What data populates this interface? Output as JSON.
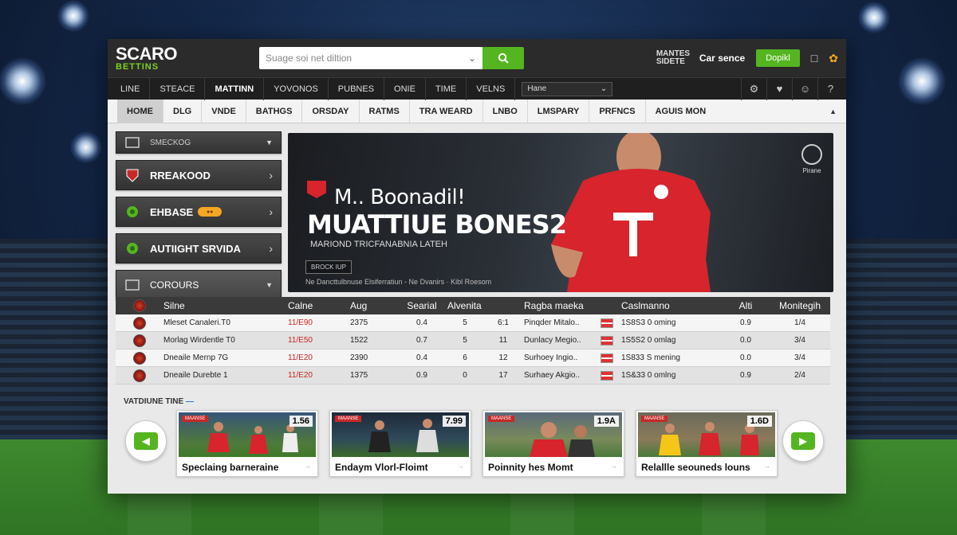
{
  "brand": {
    "line1": "SCARO",
    "line2": "BETTINS",
    "accent": "#55b520"
  },
  "search": {
    "placeholder": "Suage soi net diltion"
  },
  "topbar": {
    "link": "MANTES SIDETE",
    "user": "Car sence",
    "deposit": "Dopikl"
  },
  "nav_primary": {
    "items": [
      "LINE",
      "STEACE",
      "MATTINN",
      "YOVONOS",
      "PUBNES",
      "ONIE",
      "TIME",
      "VELNS"
    ],
    "active_index": 2,
    "select_value": "Hane"
  },
  "nav_secondary": {
    "tabs": [
      "HOME",
      "DLG",
      "VNDE",
      "BATHGS",
      "ORSDAY",
      "RATMS",
      "TRA WEARD",
      "LNBO",
      "LMSPARY",
      "PRFNCS",
      "AGUIS MON"
    ],
    "active_index": 0
  },
  "sidebar": {
    "items": [
      {
        "label": "SMECKOG"
      },
      {
        "label": "RREAKOOD"
      },
      {
        "label": "EHBASE"
      },
      {
        "label": "AUTIIGHT SRVIDA"
      },
      {
        "label": "COROURS"
      }
    ]
  },
  "hero": {
    "line1": "M.. Boonadil!",
    "line2": "MUATTIUE BONES2",
    "line3": "MARIOND TRICFANABNIA LATEH",
    "cta": "BROCK IUP",
    "fine": "Ne Dancttulbnuse Elsiferratiun - Ne Dvanirs · Kibl Roesom",
    "emblem": "Pirane"
  },
  "table": {
    "headers": [
      "Silne",
      "Calne",
      "Aug",
      "Searial",
      "Alvenita",
      "Ragba maeka",
      "Caslmanno",
      "Alti",
      "Monitegih"
    ],
    "rows": [
      {
        "name": "Mleset Canaleri.T0",
        "odds": "11/E90",
        "avg": "2375",
        "n1": "0.4",
        "n2": "5",
        "n3": "6:1",
        "partner": "Pinqder Mitalo..",
        "cash": "1S8S3 0 oming",
        "alt": "0.9",
        "mon": "1/4"
      },
      {
        "name": "Morlag Wirdentle T0",
        "odds": "11/E50",
        "avg": "1522",
        "n1": "0.7",
        "n2": "5",
        "n3": "11",
        "partner": "Dunlacy Megio..",
        "cash": "1S5S2 0 omlag",
        "alt": "0.0",
        "mon": "3/4"
      },
      {
        "name": "Dneaile Mernp 7G",
        "odds": "11/E20",
        "avg": "2390",
        "n1": "0.4",
        "n2": "6",
        "n3": "12",
        "partner": "Surhoey Ingio..",
        "cash": "1S833 S mening",
        "alt": "0.0",
        "mon": "3/4"
      },
      {
        "name": "Dneaile Durebte 1",
        "odds": "11/E20",
        "avg": "1375",
        "n1": "0.9",
        "n2": "0",
        "n3": "17",
        "partner": "Surhaey Akgio..",
        "cash": "1S&33 0 omlng",
        "alt": "0.9",
        "mon": "2/4"
      }
    ]
  },
  "featured": {
    "label": "VATDIUNE TINE",
    "dash": "—",
    "cards": [
      {
        "tag": "MAANSE",
        "odds": "1.56",
        "title": "Speclaing barneraine"
      },
      {
        "tag": "MAANSE",
        "odds": "7.99",
        "title": "Endaym Vlorl-Floimt"
      },
      {
        "tag": "MAANSE",
        "odds": "1.9A",
        "title": "Poinnity hes Momt"
      },
      {
        "tag": "MAANSE",
        "odds": "1.6D",
        "title": "Relallle seouneds louns"
      }
    ]
  }
}
